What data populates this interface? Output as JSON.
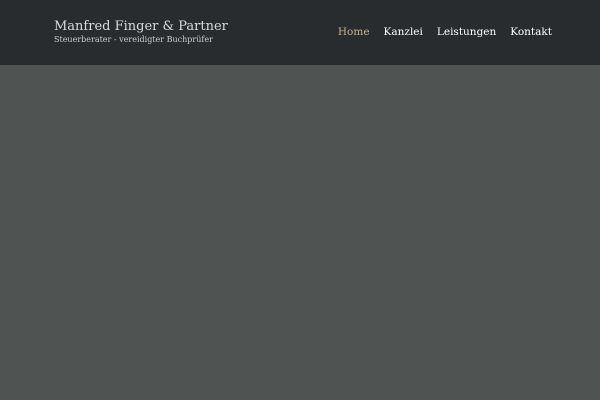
{
  "header": {
    "brand": {
      "title": "Manfred Finger & Partner",
      "subtitle": "Steuerberater - vereidigter Buchprüfer"
    },
    "nav": {
      "items": [
        {
          "label": "Home",
          "active": true
        },
        {
          "label": "Kanzlei",
          "active": false
        },
        {
          "label": "Leistungen",
          "active": false
        },
        {
          "label": "Kontakt",
          "active": false
        }
      ]
    }
  },
  "colors": {
    "header_bg": "#282c2f",
    "page_bg": "#4f5452",
    "nav_active": "#c7b48a",
    "nav_text": "#ffffff"
  }
}
